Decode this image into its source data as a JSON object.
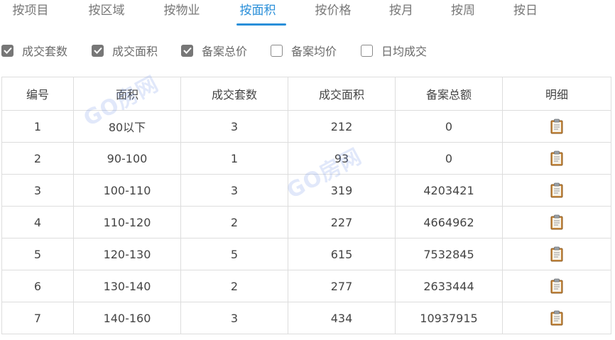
{
  "tabs": [
    {
      "label": "按项目",
      "active": false
    },
    {
      "label": "按区域",
      "active": false
    },
    {
      "label": "按物业",
      "active": false
    },
    {
      "label": "按面积",
      "active": true
    },
    {
      "label": "按价格",
      "active": false
    },
    {
      "label": "按月",
      "active": false
    },
    {
      "label": "按周",
      "active": false
    },
    {
      "label": "按日",
      "active": false
    }
  ],
  "checkboxes": [
    {
      "label": "成交套数",
      "checked": true
    },
    {
      "label": "成交面积",
      "checked": true
    },
    {
      "label": "备案总价",
      "checked": true
    },
    {
      "label": "备案均价",
      "checked": false
    },
    {
      "label": "日均成交",
      "checked": false
    }
  ],
  "table": {
    "headers": [
      "编号",
      "面积",
      "成交套数",
      "成交面积",
      "备案总额",
      "明细"
    ],
    "rows": [
      {
        "id": "1",
        "area": "80以下",
        "units": "3",
        "sqm": "212",
        "total": "0"
      },
      {
        "id": "2",
        "area": "90-100",
        "units": "1",
        "sqm": "93",
        "total": "0"
      },
      {
        "id": "3",
        "area": "100-110",
        "units": "3",
        "sqm": "319",
        "total": "4203421"
      },
      {
        "id": "4",
        "area": "110-120",
        "units": "2",
        "sqm": "227",
        "total": "4664962"
      },
      {
        "id": "5",
        "area": "120-130",
        "units": "5",
        "sqm": "615",
        "total": "7532845"
      },
      {
        "id": "6",
        "area": "130-140",
        "units": "2",
        "sqm": "277",
        "total": "2633444"
      },
      {
        "id": "7",
        "area": "140-160",
        "units": "3",
        "sqm": "434",
        "total": "10937915"
      }
    ],
    "detail_icon": "clipboard-icon"
  },
  "watermarks": [
    "GO房网",
    "GO房网"
  ],
  "colors": {
    "accent": "#2a8fd9",
    "checkbox_checked": "#777777",
    "border": "#dddddd"
  }
}
